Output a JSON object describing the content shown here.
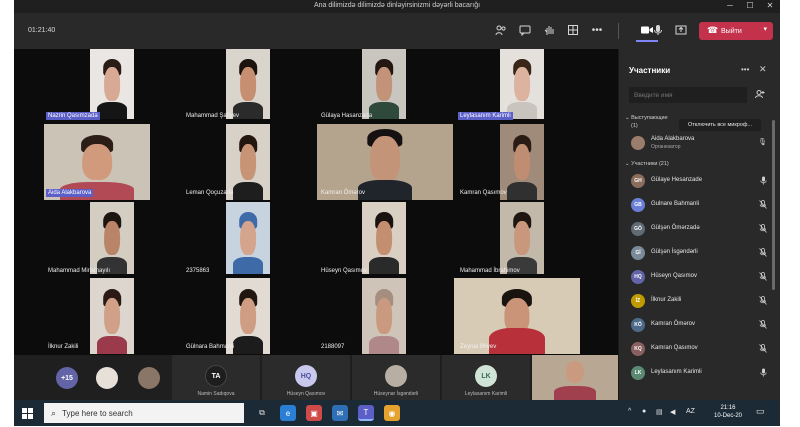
{
  "window": {
    "title": "Ana dilimizdə dilimizdə dinləyirsinizmi dəyərli bacarığı",
    "minimize_glyph": "─",
    "maximize_glyph": "☐",
    "close_glyph": "✕"
  },
  "toolbar": {
    "timer": "01:21:40",
    "leave_label": "Выйти",
    "icons": [
      "people-icon",
      "chat-icon",
      "raise-hand-icon",
      "rooms-icon",
      "more-icon",
      "camera-icon",
      "mic-icon",
      "share-icon"
    ]
  },
  "video_tiles": [
    {
      "name": "Nazrin Qasımzada",
      "highlight": true
    },
    {
      "name": "Mahammad Şafiyev",
      "highlight": false
    },
    {
      "name": "Gülaya Hasanzada",
      "highlight": false
    },
    {
      "name": "Leylasanım Karimli",
      "highlight": true
    },
    {
      "name": "Aida Alakbarova",
      "highlight": true
    },
    {
      "name": "Leman Qoçuzadə",
      "highlight": false
    },
    {
      "name": "Kamran Ömərov",
      "highlight": false
    },
    {
      "name": "Kamran Qasımov",
      "highlight": false
    },
    {
      "name": "Mahammad Mirismayılı",
      "highlight": false
    },
    {
      "name": "2375863",
      "highlight": false
    },
    {
      "name": "Hüseyn Qasımov",
      "highlight": false
    },
    {
      "name": "Mahammad İbrahimov",
      "highlight": false
    },
    {
      "name": "İlknur Zakili",
      "highlight": false
    },
    {
      "name": "Gülnara Bahmanli",
      "highlight": false
    },
    {
      "name": "2188097",
      "highlight": false
    },
    {
      "name": "Zeynal Əliyev",
      "highlight": false
    }
  ],
  "strip": {
    "overflow_count": "+15",
    "tiles": [
      {
        "initials": "TA",
        "name": "Namin Sadıqova"
      },
      {
        "initials": "HQ",
        "name": "Hüseyn Qasımov"
      },
      {
        "initials": "",
        "name": "Hüseynar İsgəndərli"
      },
      {
        "initials": "LK",
        "name": "Leylasanım Karimli"
      }
    ]
  },
  "panel": {
    "title": "Участники",
    "search_placeholder": "Введите имя",
    "presenters_label": "Выступающие",
    "presenters_count": "(1)",
    "mute_all_label": "Отключить все микроф...",
    "presenter": {
      "name": "Aida Alakbarova",
      "role": "Организатор"
    },
    "participants_label": "Участники (21)",
    "participants": [
      {
        "initials": "GH",
        "name": "Gülaye Hesanzade",
        "color": "#8a6d5b",
        "mic": "on"
      },
      {
        "initials": "GB",
        "name": "Gulnare Bahmanli",
        "color": "#6b7fd6",
        "mic": "off"
      },
      {
        "initials": "GÖ",
        "name": "Gülşən Ömərzadə",
        "color": "#5f6b74",
        "mic": "off"
      },
      {
        "initials": "Gİ",
        "name": "Gülşən İsgəndərli",
        "color": "#7a8a99",
        "mic": "off"
      },
      {
        "initials": "HQ",
        "name": "Hüseyn Qasımov",
        "color": "#6264a7",
        "mic": "off"
      },
      {
        "initials": "İZ",
        "name": "İlknur Zakili",
        "color": "#c19c00",
        "mic": "off"
      },
      {
        "initials": "KÖ",
        "name": "Kamran Ömərov",
        "color": "#4e6a8a",
        "mic": "off"
      },
      {
        "initials": "KQ",
        "name": "Kamran Qasımov",
        "color": "#8a5f5f",
        "mic": "off"
      },
      {
        "initials": "LK",
        "name": "Leylasanım Karimli",
        "color": "#5b8a72",
        "mic": "on"
      }
    ]
  },
  "taskbar": {
    "search_placeholder": "Type here to search",
    "lang": "AZ",
    "time": "21:16",
    "date": "10-Dec-20"
  },
  "colors": {
    "accent": "#5b5fc7",
    "leave": "#c4314b",
    "taskbar": "#1b2a35"
  }
}
